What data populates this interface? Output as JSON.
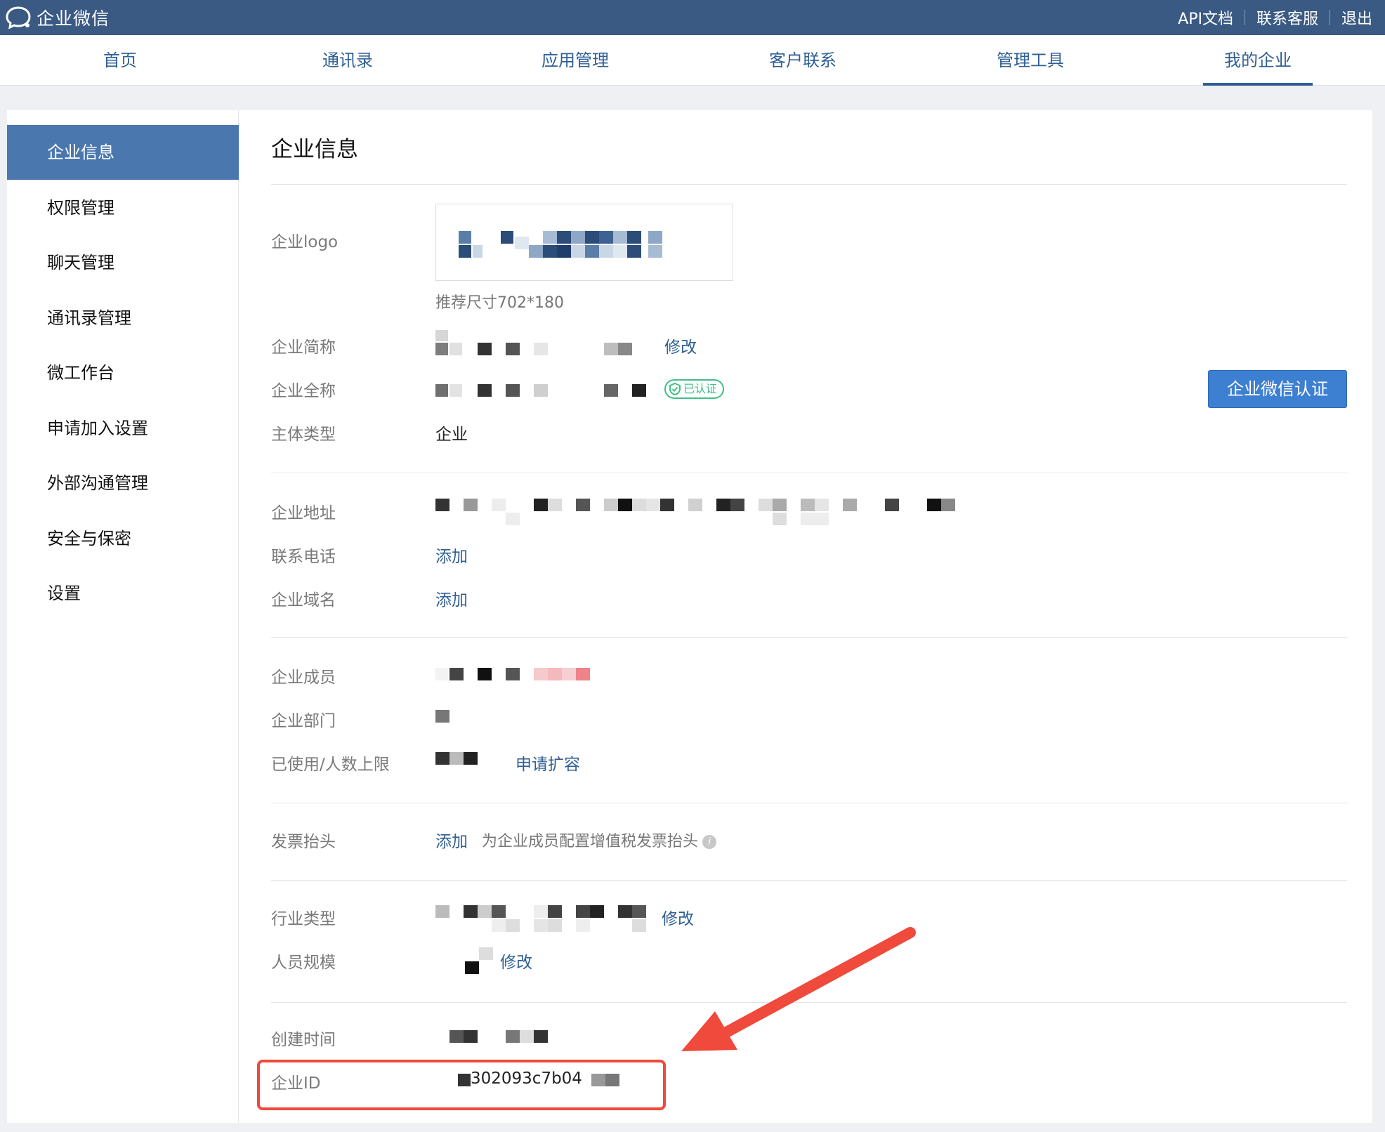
{
  "brand": {
    "name": "企业微信"
  },
  "top_links": [
    "API文档",
    "联系客服",
    "退出"
  ],
  "nav": [
    {
      "label": "首页",
      "active": false
    },
    {
      "label": "通讯录",
      "active": false
    },
    {
      "label": "应用管理",
      "active": false
    },
    {
      "label": "客户联系",
      "active": false
    },
    {
      "label": "管理工具",
      "active": false
    },
    {
      "label": "我的企业",
      "active": true
    }
  ],
  "sidebar": [
    {
      "label": "企业信息",
      "active": true
    },
    {
      "label": "权限管理",
      "active": false
    },
    {
      "label": "聊天管理",
      "active": false
    },
    {
      "label": "通讯录管理",
      "active": false
    },
    {
      "label": "微工作台",
      "active": false
    },
    {
      "label": "申请加入设置",
      "active": false
    },
    {
      "label": "外部沟通管理",
      "active": false
    },
    {
      "label": "安全与保密",
      "active": false
    },
    {
      "label": "设置",
      "active": false
    }
  ],
  "page": {
    "title": "企业信息",
    "logo": {
      "label": "企业logo",
      "hint": "推荐尺寸702*180"
    },
    "short_name": {
      "label": "企业简称",
      "action": "修改"
    },
    "full_name": {
      "label": "企业全称",
      "badge": "已认证",
      "button": "企业微信认证"
    },
    "entity_type": {
      "label": "主体类型",
      "value": "企业"
    },
    "address": {
      "label": "企业地址"
    },
    "phone": {
      "label": "联系电话",
      "action": "添加"
    },
    "domain": {
      "label": "企业域名",
      "action": "添加"
    },
    "members": {
      "label": "企业成员"
    },
    "departments": {
      "label": "企业部门"
    },
    "usage": {
      "label": "已使用/人数上限",
      "action": "申请扩容"
    },
    "invoice": {
      "label": "发票抬头",
      "action": "添加",
      "hint": "为企业成员配置增值税发票抬头"
    },
    "industry": {
      "label": "行业类型",
      "action": "修改"
    },
    "size": {
      "label": "人员规模",
      "action": "修改"
    },
    "created": {
      "label": "创建时间"
    },
    "corp_id": {
      "label": "企业ID",
      "visible_part": "302093c7b04"
    }
  },
  "colors": {
    "topbar": "#3a5a83",
    "accent": "#2f5f95",
    "button": "#3d7fd1",
    "verified": "#3fbf85",
    "highlight": "#ef4a3b"
  }
}
